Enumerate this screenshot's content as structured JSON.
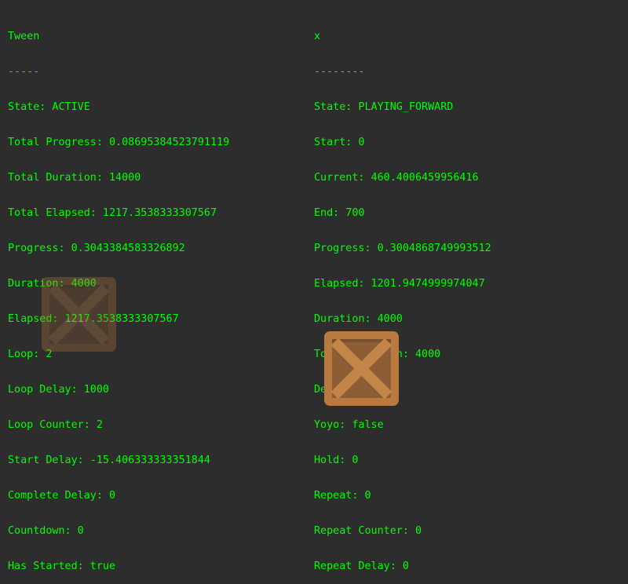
{
  "tween_panel": {
    "title": "Tween",
    "divider": "-----",
    "lines": [
      "State: ACTIVE",
      "Total Progress: 0.08695384523791119",
      "Total Duration: 14000",
      "Total Elapsed: 1217.3538333307567",
      "Progress: 0.3043384583326892",
      "Duration: 4000",
      "Elapsed: 1217.3538333307567",
      "Loop: 2",
      "Loop Delay: 1000",
      "Loop Counter: 2",
      "Start Delay: -15.406333333351844",
      "Complete Delay: 0",
      "Countdown: 0",
      "Has Started: true"
    ]
  },
  "tween_data_panel": {
    "title": "x",
    "divider": "--------",
    "lines": [
      "State: PLAYING_FORWARD",
      "Start: 0",
      "Current: 460.4006459956416",
      "End: 700",
      "Progress: 0.3004868749993512",
      "Elapsed: 1201.9474999974047",
      "Duration: 4000",
      "Total Duration: 4000",
      "Delay: 0",
      "Yoyo: false",
      "Hold: 0",
      "Repeat: 0",
      "Repeat Counter: 0",
      "Repeat Delay: 0"
    ]
  },
  "sprites": {
    "ghost_crate": {
      "icon": "crate-icon",
      "alpha": 0.32
    },
    "active_crate": {
      "icon": "crate-icon",
      "alpha": 1
    }
  },
  "colors": {
    "background": "#2d2d2d",
    "text": "#00ff00",
    "crate_frame": "#b97a3f",
    "crate_panel": "#8d5e36",
    "crate_cross": "#c48648"
  }
}
